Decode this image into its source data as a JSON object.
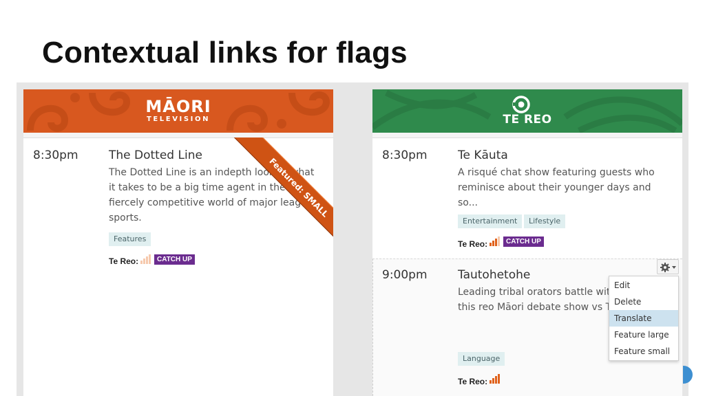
{
  "slide": {
    "title": "Contextual links for flags"
  },
  "left_channel": {
    "brand_color": "#d8581f",
    "logo_main": "MĀORI",
    "logo_sub": "TELEVISION",
    "listing": {
      "time": "8:30pm",
      "title": "The Dotted Line",
      "description": "The Dotted Line is an indepth look at what it takes to be a big time agent in the fiercely competitive world of major league sports.",
      "tags": [
        "Features"
      ],
      "te_reo_label": "Te Reo:",
      "te_reo_level": 1,
      "catch_up": "CATCH UP",
      "ribbon": "Featured: SMALL"
    }
  },
  "right_channel": {
    "brand_color": "#2f8a4c",
    "logo_text": "TE REO",
    "listings": [
      {
        "time": "8:30pm",
        "title": "Te Kāuta",
        "description": "A risqué chat show featuring guests who reminisce about their younger days and so...",
        "tags": [
          "Entertainment",
          "Lifestyle"
        ],
        "te_reo_label": "Te Reo:",
        "te_reo_level": 3,
        "catch_up": "CATCH UP"
      },
      {
        "time": "9:00pm",
        "title": "Tautohetohe",
        "description": "Leading tribal orators battle with words in this reo Māori debate show vs Te Aupouri.",
        "tags": [
          "Language"
        ],
        "te_reo_label": "Te Reo:",
        "te_reo_level": 4
      }
    ]
  },
  "context_menu": {
    "items": [
      "Edit",
      "Delete",
      "Translate",
      "Feature large",
      "Feature small"
    ],
    "highlighted": "Translate"
  },
  "colors": {
    "catch_up": "#6b2c8f",
    "bar_active": "#e0621c",
    "bar_inactive": "#f6c9ad",
    "tag_bg": "#e0eff0",
    "ribbon": "#cf5314"
  }
}
